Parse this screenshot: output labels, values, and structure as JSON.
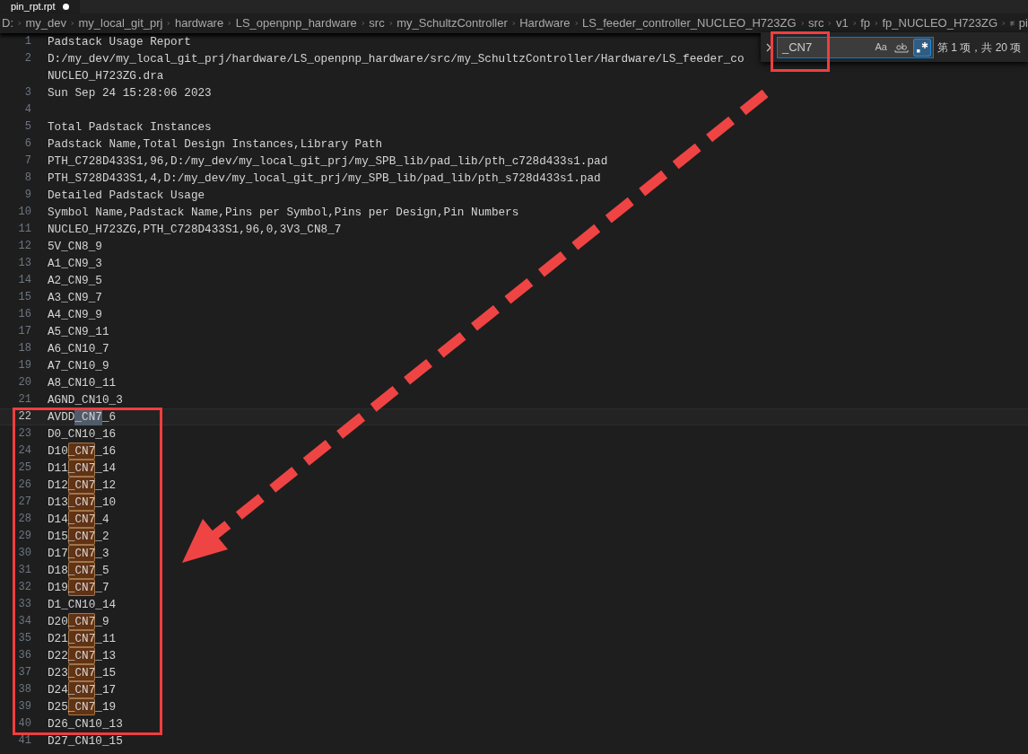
{
  "tab": {
    "title": "pin_rpt.rpt",
    "modified": true
  },
  "breadcrumb": [
    "D:",
    "my_dev",
    "my_local_git_prj",
    "hardware",
    "LS_openpnp_hardware",
    "src",
    "my_SchultzController",
    "Hardware",
    "LS_feeder_controller_NUCLEO_H723ZG",
    "src",
    "v1",
    "fp",
    "fp_NUCLEO_H723ZG",
    "pi"
  ],
  "find": {
    "value": "_CN7",
    "match_case_label": "Aa",
    "match_case": false,
    "whole_word": false,
    "regex": true,
    "result": "第 1 项，共 20 项"
  },
  "lines": [
    {
      "number": "1",
      "text": "Padstack Usage Report"
    },
    {
      "number": "2",
      "text": "D:/my_dev/my_local_git_prj/hardware/LS_openpnp_hardware/src/my_SchultzController/Hardware/LS_feeder_co",
      "wrap": "NUCLEO_H723ZG.dra"
    },
    {
      "number": "3",
      "text": "Sun Sep 24 15:28:06 2023"
    },
    {
      "number": "4"
    },
    {
      "number": "5",
      "text": "Total Padstack Instances"
    },
    {
      "number": "6",
      "text": "Padstack Name,Total Design Instances,Library Path"
    },
    {
      "number": "7",
      "text": "PTH_C728D433S1,96,D:/my_dev/my_local_git_prj/my_SPB_lib/pad_lib/pth_c728d433s1.pad"
    },
    {
      "number": "8",
      "text": "PTH_S728D433S1,4,D:/my_dev/my_local_git_prj/my_SPB_lib/pad_lib/pth_s728d433s1.pad"
    },
    {
      "number": "9",
      "text": "Detailed Padstack Usage"
    },
    {
      "number": "10",
      "text": "Symbol Name,Padstack Name,Pins per Symbol,Pins per Design,Pin Numbers"
    },
    {
      "number": "11",
      "text": "NUCLEO_H723ZG,PTH_C728D433S1,96,0,3V3_CN8_7"
    },
    {
      "number": "12",
      "text": "5V_CN8_9"
    },
    {
      "number": "13",
      "text": "A1_CN9_3"
    },
    {
      "number": "14",
      "text": "A2_CN9_5"
    },
    {
      "number": "15",
      "text": "A3_CN9_7"
    },
    {
      "number": "16",
      "text": "A4_CN9_9"
    },
    {
      "number": "17",
      "text": "A5_CN9_11"
    },
    {
      "number": "18",
      "text": "A6_CN10_7"
    },
    {
      "number": "19",
      "text": "A7_CN10_9"
    },
    {
      "number": "20",
      "text": "A8_CN10_11"
    },
    {
      "number": "21",
      "text": "AGND_CN10_3"
    },
    {
      "number": "22",
      "before": "AVDD",
      "match": "_CN7",
      "after": "_6",
      "current": true
    },
    {
      "number": "23",
      "text": "D0_CN10_16"
    },
    {
      "number": "24",
      "before": "D10",
      "match": "_CN7",
      "after": "_16",
      "current": false
    },
    {
      "number": "25",
      "before": "D11",
      "match": "_CN7",
      "after": "_14",
      "current": false
    },
    {
      "number": "26",
      "before": "D12",
      "match": "_CN7",
      "after": "_12",
      "current": false
    },
    {
      "number": "27",
      "before": "D13",
      "match": "_CN7",
      "after": "_10",
      "current": false
    },
    {
      "number": "28",
      "before": "D14",
      "match": "_CN7",
      "after": "_4",
      "current": false
    },
    {
      "number": "29",
      "before": "D15",
      "match": "_CN7",
      "after": "_2",
      "current": false
    },
    {
      "number": "30",
      "before": "D17",
      "match": "_CN7",
      "after": "_3",
      "current": false
    },
    {
      "number": "31",
      "before": "D18",
      "match": "_CN7",
      "after": "_5",
      "current": false
    },
    {
      "number": "32",
      "before": "D19",
      "match": "_CN7",
      "after": "_7",
      "current": false
    },
    {
      "number": "33",
      "text": "D1_CN10_14"
    },
    {
      "number": "34",
      "before": "D20",
      "match": "_CN7",
      "after": "_9",
      "current": false
    },
    {
      "number": "35",
      "before": "D21",
      "match": "_CN7",
      "after": "_11",
      "current": false
    },
    {
      "number": "36",
      "before": "D22",
      "match": "_CN7",
      "after": "_13",
      "current": false
    },
    {
      "number": "37",
      "before": "D23",
      "match": "_CN7",
      "after": "_15",
      "current": false
    },
    {
      "number": "38",
      "before": "D24",
      "match": "_CN7",
      "after": "_17",
      "current": false
    },
    {
      "number": "39",
      "before": "D25",
      "match": "_CN7",
      "after": "_19",
      "current": false
    },
    {
      "number": "40",
      "text": "D26_CN10_13"
    },
    {
      "number": "41",
      "text": "D27_CN10_15"
    }
  ]
}
